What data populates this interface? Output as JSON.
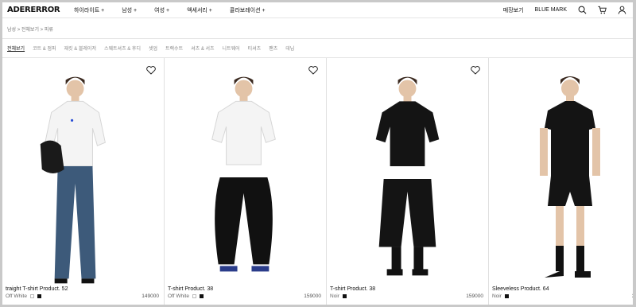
{
  "brand": {
    "logo": "ADERERROR"
  },
  "nav": [
    {
      "label": "하이라이트 +"
    },
    {
      "label": "남성 +"
    },
    {
      "label": "여성 +"
    },
    {
      "label": "액세서리 +"
    },
    {
      "label": "콜라보레이션 +"
    }
  ],
  "utility": {
    "stores": "매장보기",
    "sub_brand": "BLUE MARK"
  },
  "breadcrumb": "남성 > 전체보기 > 피류",
  "tabs": [
    {
      "label": "전체보기",
      "active": true
    },
    {
      "label": "코트 & 점퍼"
    },
    {
      "label": "재킷 & 블레이저"
    },
    {
      "label": "스웨트셔츠 & 후디"
    },
    {
      "label": "셋업"
    },
    {
      "label": "트랙수트"
    },
    {
      "label": "셔츠 & 서츠"
    },
    {
      "label": "니트웨어"
    },
    {
      "label": "티셔츠"
    },
    {
      "label": "팬츠"
    },
    {
      "label": "데님"
    }
  ],
  "products": [
    {
      "name": "traight T-shirt Product. 52",
      "color": "Off White",
      "swatches": [
        "white",
        "black"
      ],
      "price": "149000",
      "top": "#f4f4f4",
      "bottom": "#3d5a7a"
    },
    {
      "name": "T-shirt Product. 38",
      "color": "Off White",
      "swatches": [
        "white",
        "black"
      ],
      "price": "159000",
      "top": "#f4f4f4",
      "bottom": "#111111"
    },
    {
      "name": "T-shirt Product. 38",
      "color": "Noir",
      "swatches": [
        "black"
      ],
      "price": "159000",
      "top": "#141414",
      "bottom": "#141414"
    },
    {
      "name": "Sleeveless Product. 64",
      "color": "Noir",
      "swatches": [
        "black"
      ],
      "price": "37900",
      "top": "#141414",
      "bottom": "#141414"
    }
  ]
}
